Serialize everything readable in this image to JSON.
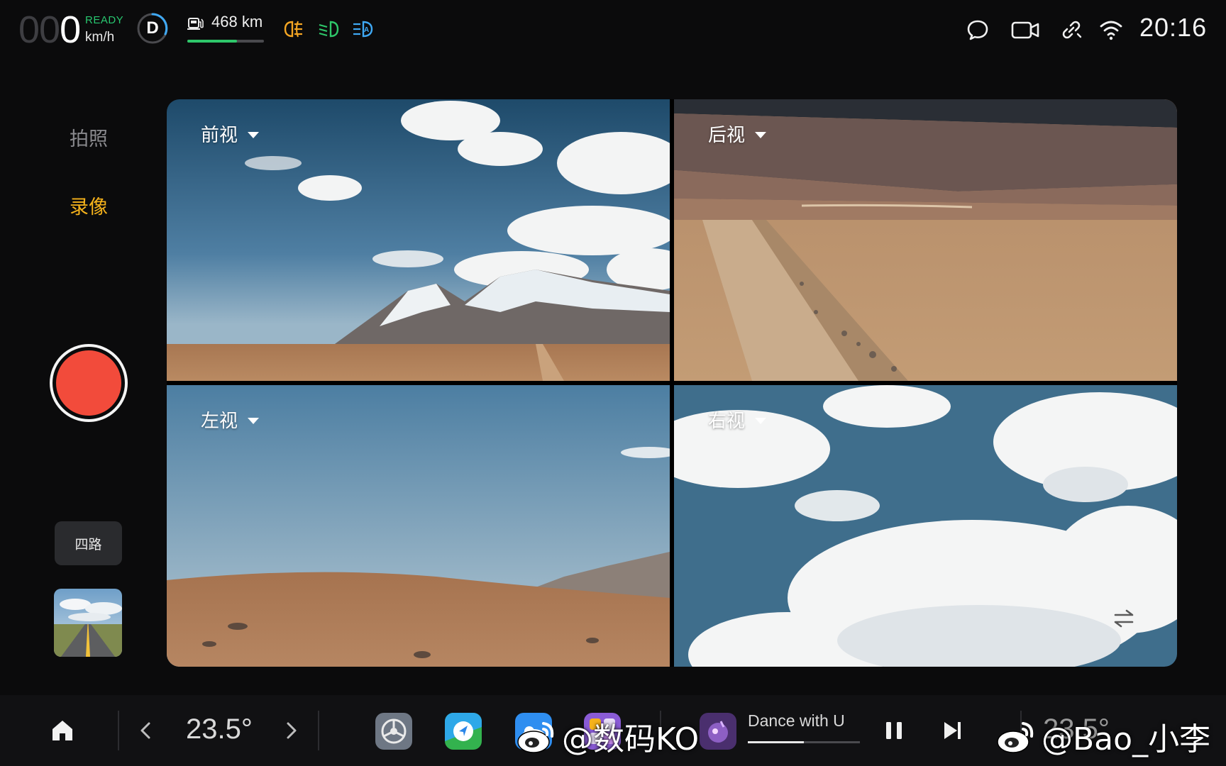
{
  "status": {
    "speed_dim": "00",
    "speed_lit": "0",
    "ready": "READY",
    "speed_unit": "km/h",
    "gear": "D",
    "range": "468 km",
    "range_level": 0.65,
    "time": "20:16",
    "colors": {
      "ready": "#28c76f",
      "fog_lamp": "#f5a623",
      "low_beam": "#2ec76a",
      "auto_beam": "#3fa9f5"
    },
    "left_icons": [
      "fog-lamp-icon",
      "low-beam-icon",
      "auto-high-beam-icon"
    ],
    "right_icons": [
      "message-icon",
      "camera-icon",
      "link-icon",
      "wifi-icon"
    ]
  },
  "left_panel": {
    "mode_photo": "拍照",
    "mode_video": "录像",
    "active_mode": "录像",
    "layout_label": "四路",
    "record_color": "#f24b3b"
  },
  "cameras": [
    {
      "label": "前视"
    },
    {
      "label": "后视"
    },
    {
      "label": "左视"
    },
    {
      "label": "右视"
    }
  ],
  "dock": {
    "temp_left": "23.5°",
    "temp_right": "23.5°",
    "apps": [
      "settings-app-icon",
      "navigation-app-icon",
      "weather-app-icon",
      "app-store-icon",
      "music-app-icon"
    ],
    "song_title": "Dance with U",
    "song_progress": 0.5
  },
  "watermarks": {
    "left": "@数码KO",
    "right": "@Bao_小李"
  }
}
